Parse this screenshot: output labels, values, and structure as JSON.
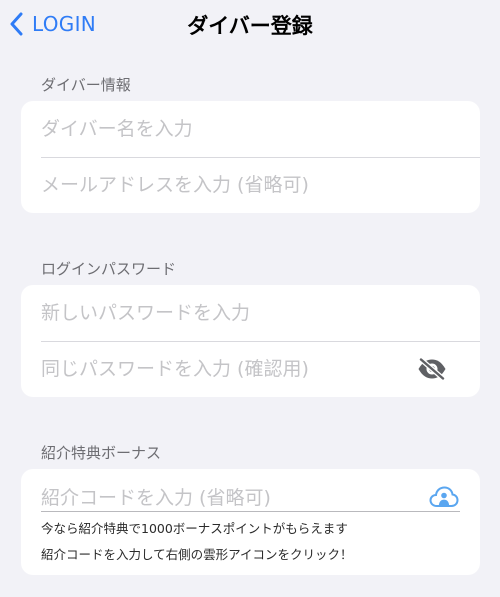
{
  "navbar": {
    "back_label": "LOGIN",
    "title": "ダイバー登録"
  },
  "diver_info": {
    "header": "ダイバー情報",
    "name_placeholder": "ダイバー名を入力",
    "email_placeholder": "メールアドレスを入力 (省略可)"
  },
  "password": {
    "header": "ログインパスワード",
    "new_placeholder": "新しいパスワードを入力",
    "confirm_placeholder": "同じパスワードを入力 (確認用)"
  },
  "referral": {
    "header": "紹介特典ボーナス",
    "code_placeholder": "紹介コードを入力 (省略可)",
    "hint_line1": "今なら紹介特典で1000ボーナスポイントがもらえます",
    "hint_line2": "紹介コードを入力して右側の雲形アイコンをクリック！"
  },
  "colors": {
    "accent": "#2f7cf6",
    "background": "#f2f2f7",
    "placeholder": "#c4c4c7",
    "cloud_icon": "#5aa6f0"
  },
  "icons": {
    "back": "chevron-left-icon",
    "password_toggle": "eye-slash-icon",
    "referral_submit": "cloud-person-icon"
  }
}
